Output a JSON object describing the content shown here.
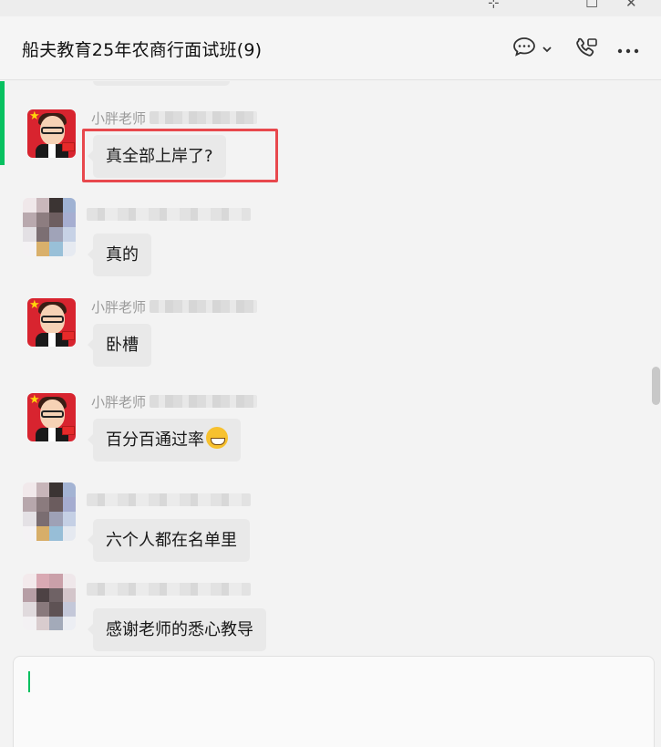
{
  "window": {
    "controls": {
      "pin": "⊹",
      "maximize": "□",
      "close": "✕"
    }
  },
  "header": {
    "title": "船夫教育25年农商行面试班(9)",
    "icons": [
      "chat-bubble-icon",
      "chevron-down-icon",
      "video-call-icon",
      "more-icon"
    ]
  },
  "colors": {
    "accent": "#07c160",
    "bubble": "#e9e9e9",
    "highlight": "#e8484d"
  },
  "messages": [
    {
      "sender": "小胖老师",
      "avatar": "teacher",
      "text": "真全部上岸了?",
      "highlighted": true
    },
    {
      "sender": "",
      "avatar": "mosaic",
      "text": "真的",
      "highlighted": false
    },
    {
      "sender": "小胖老师",
      "avatar": "teacher",
      "text": "卧槽",
      "highlighted": false
    },
    {
      "sender": "小胖老师",
      "avatar": "teacher",
      "text": "百分百通过率",
      "emoji": "grinning-face",
      "highlighted": false
    },
    {
      "sender": "",
      "avatar": "mosaic",
      "text": "六个人都在名单里",
      "highlighted": false
    },
    {
      "sender": "",
      "avatar": "mosaic",
      "text": "感谢老师的悉心教导",
      "highlighted": false
    }
  ],
  "input": {
    "value": ""
  }
}
